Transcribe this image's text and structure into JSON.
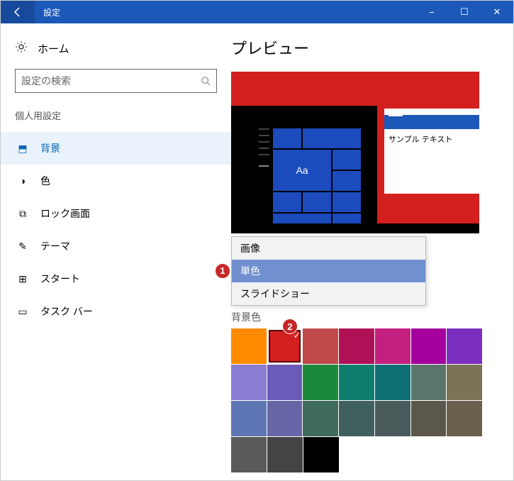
{
  "titlebar": {
    "title": "設定",
    "back": "←",
    "minimize": "−",
    "maximize": "☐",
    "close": "✕"
  },
  "sidebar": {
    "home": "ホーム",
    "search_placeholder": "設定の検索",
    "category": "個人用設定",
    "items": [
      {
        "icon": "⬒",
        "label": "背景",
        "active": true
      },
      {
        "icon": "◑",
        "label": "色"
      },
      {
        "icon": "⧉",
        "label": "ロック画面"
      },
      {
        "icon": "✎",
        "label": "テーマ"
      },
      {
        "icon": "⊞",
        "label": "スタート"
      },
      {
        "icon": "▭",
        "label": "タスク バー"
      }
    ]
  },
  "content": {
    "preview_heading": "プレビュー",
    "sample_text": "サンプル テキスト",
    "tile_text": "Aa",
    "dropdown": {
      "options": [
        {
          "label": "画像"
        },
        {
          "label": "単色",
          "selected": true
        },
        {
          "label": "スライドショー"
        }
      ]
    },
    "color_section_label": "背景色",
    "markers": {
      "m1": "1",
      "m2": "2"
    },
    "check": "✓",
    "color_rows": [
      [
        "#ff8c00",
        "#d41f1f",
        "#c04a4a",
        "#b01055",
        "#c21f80",
        "#a3009e",
        "#7b2fbf"
      ],
      [
        "#8a7cd0",
        "#6b5bb8",
        "#1a8a3a",
        "#0e7d6e",
        "#0e7075",
        "#5a766a",
        "#7a7358"
      ],
      [
        "#5f76b4",
        "#6666a6",
        "#3f6b5a",
        "#406060",
        "#4a5a5a",
        "#5a584a",
        "#6a604e"
      ],
      [
        "#5a5a5a",
        "#444444",
        "#000000"
      ]
    ],
    "selected_color_index": [
      0,
      1
    ]
  }
}
